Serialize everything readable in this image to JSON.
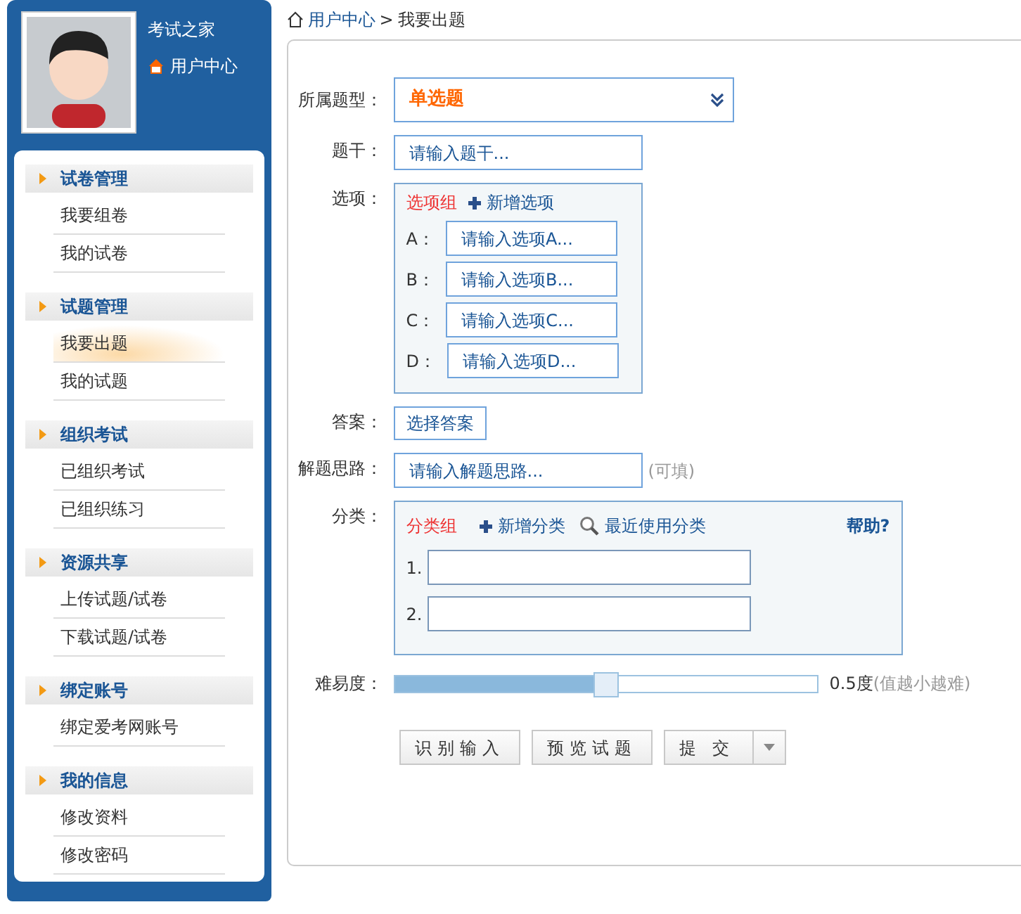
{
  "profile": {
    "site_name": "考试之家",
    "user_center_link": "用户中心"
  },
  "sidebar": {
    "sections": [
      {
        "title": "试卷管理",
        "items": [
          {
            "label": "我要组卷",
            "selected": false
          },
          {
            "label": "我的试卷",
            "selected": false
          }
        ]
      },
      {
        "title": "试题管理",
        "items": [
          {
            "label": "我要出题",
            "selected": true
          },
          {
            "label": "我的试题",
            "selected": false
          }
        ]
      },
      {
        "title": "组织考试",
        "items": [
          {
            "label": "已组织考试",
            "selected": false
          },
          {
            "label": "已组织练习",
            "selected": false
          }
        ]
      },
      {
        "title": "资源共享",
        "items": [
          {
            "label": "上传试题/试卷",
            "selected": false
          },
          {
            "label": "下载试题/试卷",
            "selected": false
          }
        ]
      },
      {
        "title": "绑定账号",
        "items": [
          {
            "label": "绑定爱考网账号",
            "selected": false
          }
        ]
      },
      {
        "title": "我的信息",
        "items": [
          {
            "label": "修改资料",
            "selected": false
          },
          {
            "label": "修改密码",
            "selected": false
          }
        ]
      }
    ]
  },
  "breadcrumb": {
    "link": "用户中心",
    "separator": ">",
    "current": "我要出题"
  },
  "form": {
    "type": {
      "label": "所属题型：",
      "value": "单选题"
    },
    "stem": {
      "label": "题干：",
      "placeholder": "请输入题干..."
    },
    "options": {
      "label": "选项：",
      "group_label": "选项组",
      "add_link": "新增选项",
      "items": [
        {
          "letter": "A：",
          "placeholder": "请输入选项A..."
        },
        {
          "letter": "B：",
          "placeholder": "请输入选项B..."
        },
        {
          "letter": "C：",
          "placeholder": "请输入选项C..."
        },
        {
          "letter": "D：",
          "placeholder": "请输入选项D..."
        }
      ]
    },
    "answer": {
      "label": "答案：",
      "button": "选择答案"
    },
    "analysis": {
      "label": "解题思路：",
      "placeholder": "请输入解题思路...",
      "hint": "(可填)"
    },
    "category": {
      "label": "分类：",
      "group_label": "分类组",
      "add_link": "新增分类",
      "recent_link": "最近使用分类",
      "help_link": "帮助?",
      "items": [
        {
          "number": "1."
        },
        {
          "number": "2."
        }
      ]
    },
    "difficulty": {
      "label": "难易度：",
      "level": 0.5,
      "reading": "0.5度",
      "hint": "(值越小越难)"
    },
    "buttons": {
      "recognize": "识别输入",
      "preview": "预览试题",
      "submit": "提 交"
    }
  }
}
